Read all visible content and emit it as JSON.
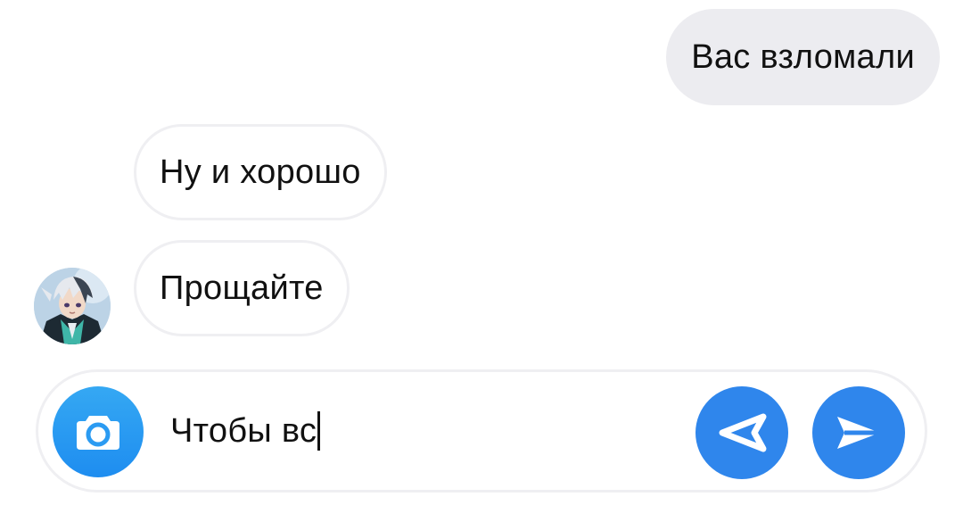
{
  "chat": {
    "messages": [
      {
        "direction": "outgoing",
        "text": "Вас взломали"
      },
      {
        "direction": "incoming",
        "text": "Ну и хорошо"
      },
      {
        "direction": "incoming",
        "text": "Прощайте"
      }
    ],
    "avatar_icon": "anime-character-avatar"
  },
  "composer": {
    "camera_icon": "camera-icon",
    "input_value": "Чтобы вс",
    "back_icon": "arrow-left-icon",
    "send_icon": "send-icon"
  },
  "colors": {
    "outgoing_bubble": "#ececf0",
    "incoming_border": "#efeff2",
    "camera_button": "#2b9bf2",
    "action_button": "#2f86ec"
  }
}
